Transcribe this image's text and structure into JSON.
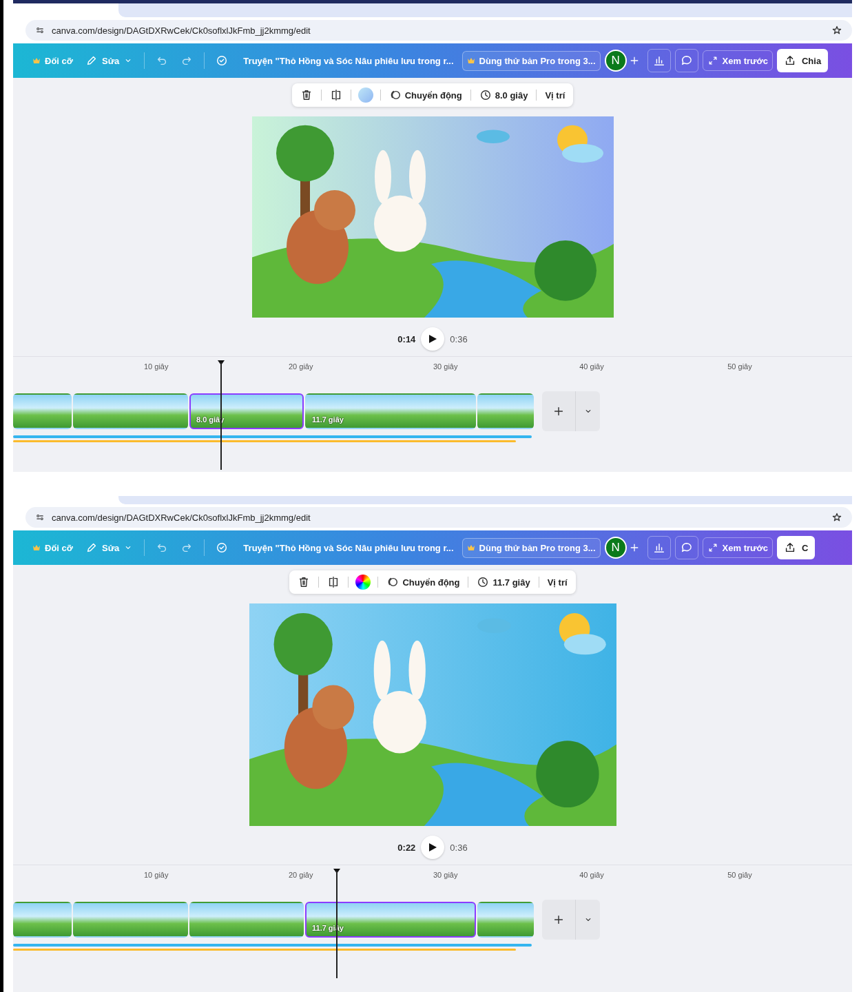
{
  "screenshots": [
    {
      "address": {
        "url": "canva.com/design/DAGtDXRwCek/Ck0soflxlJkFmb_jj2kmmg/edit"
      },
      "toolbar": {
        "resize": "Đối cỡ",
        "edit": "Sửa",
        "title": "Truyện \"Thỏ Hồng và Sóc Nâu phiêu lưu trong r...",
        "pro": "Dùng thử bản Pro trong 3...",
        "avatar": "N",
        "preview": "Xem trước",
        "share": "Chia"
      },
      "element_toolbar": {
        "rainbow_swatch": false,
        "animate": "Chuyển động",
        "duration": "8.0 giây",
        "position": "Vị trí"
      },
      "playback": {
        "current": "0:14",
        "total": "0:36"
      },
      "ruler": [
        "10 giây",
        "20 giây",
        "30 giây",
        "40 giây",
        "50 giây"
      ],
      "clips": [
        {
          "selected": false
        },
        {
          "selected": false
        },
        {
          "selected": true,
          "label": "8.0 giây"
        },
        {
          "selected": false,
          "label": "11.7 giây"
        },
        {
          "selected": false
        }
      ]
    },
    {
      "address": {
        "url": "canva.com/design/DAGtDXRwCek/Ck0soflxlJkFmb_jj2kmmg/edit"
      },
      "toolbar": {
        "resize": "Đối cỡ",
        "edit": "Sửa",
        "title": "Truyện \"Thỏ Hồng và Sóc Nâu phiêu lưu trong r...",
        "pro": "Dùng thử bản Pro trong 3...",
        "avatar": "N",
        "preview": "Xem trước",
        "share": "C"
      },
      "element_toolbar": {
        "rainbow_swatch": true,
        "animate": "Chuyển động",
        "duration": "11.7 giây",
        "position": "Vị trí"
      },
      "playback": {
        "current": "0:22",
        "total": "0:36"
      },
      "ruler": [
        "10 giây",
        "20 giây",
        "30 giây",
        "40 giây",
        "50 giây"
      ],
      "clips": [
        {
          "selected": false
        },
        {
          "selected": false
        },
        {
          "selected": false
        },
        {
          "selected": true,
          "label": "11.7 giây"
        },
        {
          "selected": false
        }
      ]
    }
  ]
}
